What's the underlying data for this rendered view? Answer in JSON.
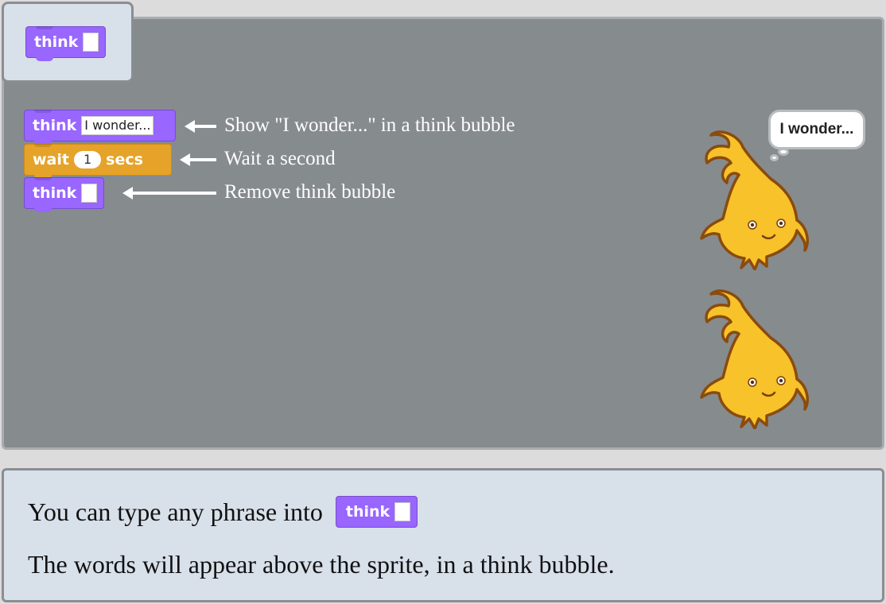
{
  "palette": {
    "think_label": "think",
    "think_input": ""
  },
  "script": {
    "think1_label": "think",
    "think1_input": "I wonder...",
    "wait_label": "wait",
    "wait_value": "1",
    "wait_unit": "secs",
    "think2_label": "think",
    "think2_input": ""
  },
  "notes": {
    "show": "Show \"I wonder...\" in a think bubble",
    "wait": "Wait a second",
    "remove": "Remove think bubble"
  },
  "stage": {
    "bubble_text": "I wonder..."
  },
  "caption": {
    "line1": "You can type any phrase into",
    "block_label": "think",
    "line2": "The words will appear above the sprite, in a think bubble."
  },
  "colors": {
    "looks": "#9966ff",
    "control": "#e5a32a",
    "stage_bg": "#868b8e",
    "panel_bg": "#d8e0ea"
  }
}
